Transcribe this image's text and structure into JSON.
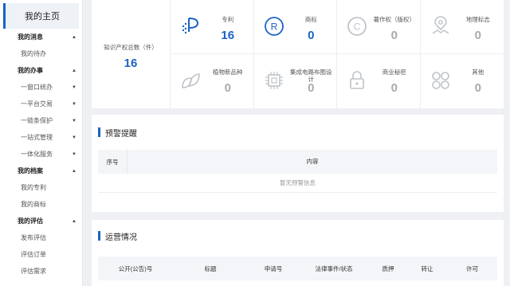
{
  "sidebar": {
    "home": "我的主页",
    "sections": [
      {
        "label": "我的消息",
        "items": [
          "我的待办"
        ]
      },
      {
        "label": "我的办事",
        "items": [
          "一窗口统办",
          "一平台交易",
          "一链条保护",
          "一站式管理",
          "一体化服务"
        ]
      },
      {
        "label": "我的档案",
        "items": [
          "我的专利",
          "我的商标"
        ]
      },
      {
        "label": "我的评估",
        "items": [
          "发布评估",
          "评估订单",
          "评估需求"
        ]
      }
    ]
  },
  "stats": {
    "total_label": "知识产权总数（件）",
    "total_value": "16",
    "cells": [
      {
        "label": "专利",
        "value": "16",
        "icon": "patent-icon"
      },
      {
        "label": "商标",
        "value": "0",
        "icon": "trademark-icon"
      },
      {
        "label": "著作权（版权）",
        "value": "0",
        "icon": "copyright-icon"
      },
      {
        "label": "地理标志",
        "value": "0",
        "icon": "geo-mark-icon"
      },
      {
        "label": "植物新品种",
        "value": "0",
        "icon": "plant-icon"
      },
      {
        "label": "集成电路布图设计",
        "value": "0",
        "icon": "chip-icon"
      },
      {
        "label": "商业秘密",
        "value": "0",
        "icon": "lock-icon"
      },
      {
        "label": "其他",
        "value": "0",
        "icon": "grid-icon"
      }
    ]
  },
  "warning": {
    "title": "预警提醒",
    "col_index": "序号",
    "col_content": "内容",
    "empty": "暂无预警信息"
  },
  "operations": {
    "title": "运营情况",
    "columns": [
      "公开(公告)号",
      "标题",
      "申请号",
      "法律事件/状态",
      "质押",
      "转让",
      "许可"
    ]
  },
  "colors": {
    "accent": "#1a62c5",
    "muted_icon": "#bfc3c9"
  }
}
